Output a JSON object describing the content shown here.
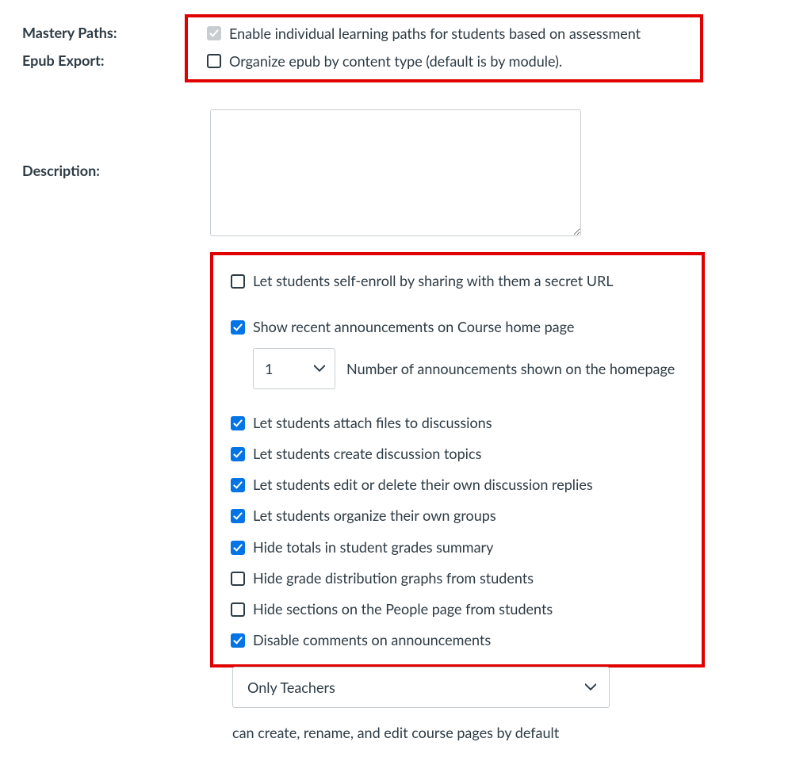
{
  "labels": {
    "mastery_paths": "Mastery Paths:",
    "epub_export": "Epub Export:",
    "description": "Description:"
  },
  "mastery_paths": {
    "enable_label": "Enable individual learning paths for students based on assessment"
  },
  "epub": {
    "organize_label": "Organize epub by content type (default is by module)."
  },
  "description_value": "",
  "options": {
    "self_enroll": "Let students self-enroll by sharing with them a secret URL",
    "show_announcements": "Show recent announcements on Course home page",
    "announcements_count": "1",
    "announcements_count_label": "Number of announcements shown on the homepage",
    "attach_files": "Let students attach files to discussions",
    "create_topics": "Let students create discussion topics",
    "edit_replies": "Let students edit or delete their own discussion replies",
    "organize_groups": "Let students organize their own groups",
    "hide_totals": "Hide totals in student grades summary",
    "hide_distribution": "Hide grade distribution graphs from students",
    "hide_sections": "Hide sections on the People page from students",
    "disable_comments": "Disable comments on announcements"
  },
  "pages_edit": {
    "selected": "Only Teachers",
    "helper": "can create, rename, and edit course pages by default"
  }
}
